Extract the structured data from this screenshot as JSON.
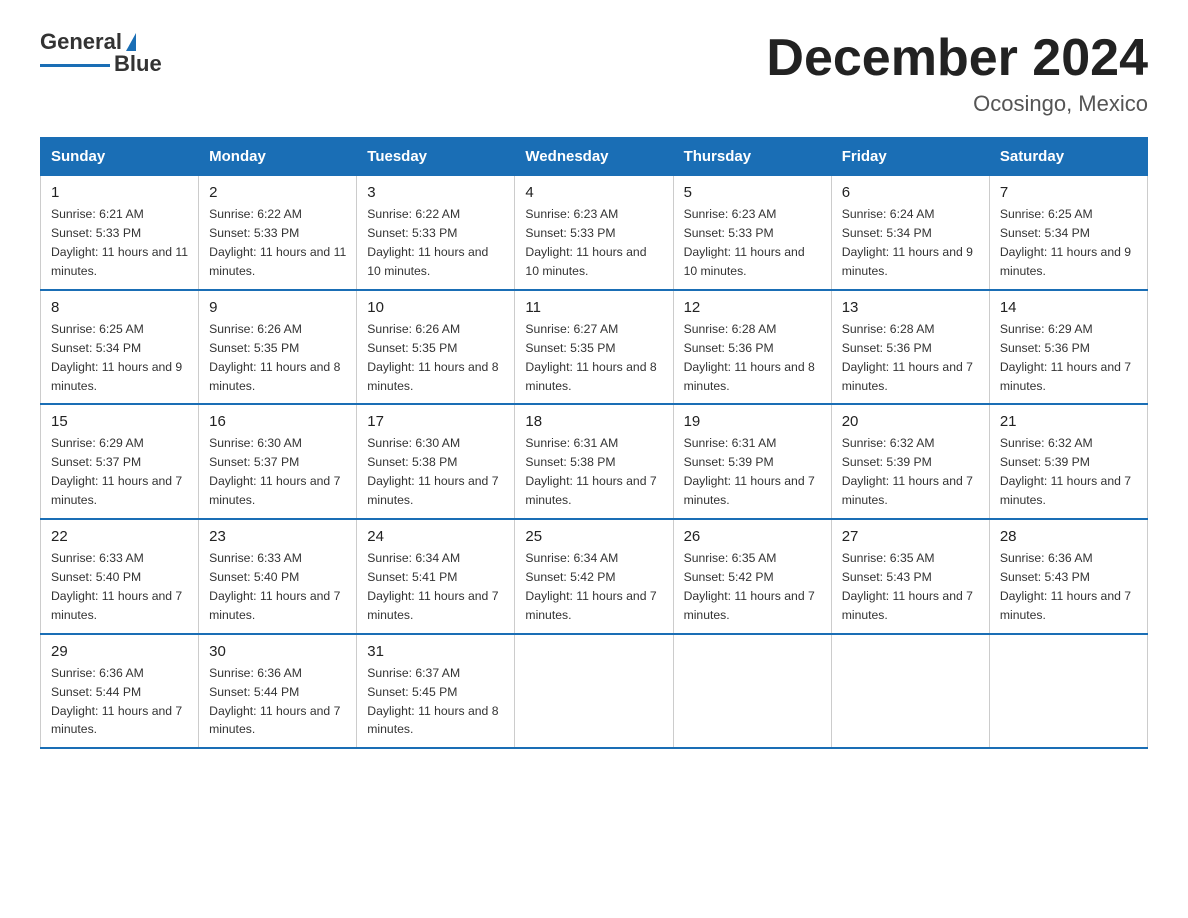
{
  "logo": {
    "general": "General",
    "blue": "Blue"
  },
  "title": "December 2024",
  "location": "Ocosingo, Mexico",
  "days_of_week": [
    "Sunday",
    "Monday",
    "Tuesday",
    "Wednesday",
    "Thursday",
    "Friday",
    "Saturday"
  ],
  "weeks": [
    [
      {
        "day": "1",
        "sunrise": "6:21 AM",
        "sunset": "5:33 PM",
        "daylight": "11 hours and 11 minutes."
      },
      {
        "day": "2",
        "sunrise": "6:22 AM",
        "sunset": "5:33 PM",
        "daylight": "11 hours and 11 minutes."
      },
      {
        "day": "3",
        "sunrise": "6:22 AM",
        "sunset": "5:33 PM",
        "daylight": "11 hours and 10 minutes."
      },
      {
        "day": "4",
        "sunrise": "6:23 AM",
        "sunset": "5:33 PM",
        "daylight": "11 hours and 10 minutes."
      },
      {
        "day": "5",
        "sunrise": "6:23 AM",
        "sunset": "5:33 PM",
        "daylight": "11 hours and 10 minutes."
      },
      {
        "day": "6",
        "sunrise": "6:24 AM",
        "sunset": "5:34 PM",
        "daylight": "11 hours and 9 minutes."
      },
      {
        "day": "7",
        "sunrise": "6:25 AM",
        "sunset": "5:34 PM",
        "daylight": "11 hours and 9 minutes."
      }
    ],
    [
      {
        "day": "8",
        "sunrise": "6:25 AM",
        "sunset": "5:34 PM",
        "daylight": "11 hours and 9 minutes."
      },
      {
        "day": "9",
        "sunrise": "6:26 AM",
        "sunset": "5:35 PM",
        "daylight": "11 hours and 8 minutes."
      },
      {
        "day": "10",
        "sunrise": "6:26 AM",
        "sunset": "5:35 PM",
        "daylight": "11 hours and 8 minutes."
      },
      {
        "day": "11",
        "sunrise": "6:27 AM",
        "sunset": "5:35 PM",
        "daylight": "11 hours and 8 minutes."
      },
      {
        "day": "12",
        "sunrise": "6:28 AM",
        "sunset": "5:36 PM",
        "daylight": "11 hours and 8 minutes."
      },
      {
        "day": "13",
        "sunrise": "6:28 AM",
        "sunset": "5:36 PM",
        "daylight": "11 hours and 7 minutes."
      },
      {
        "day": "14",
        "sunrise": "6:29 AM",
        "sunset": "5:36 PM",
        "daylight": "11 hours and 7 minutes."
      }
    ],
    [
      {
        "day": "15",
        "sunrise": "6:29 AM",
        "sunset": "5:37 PM",
        "daylight": "11 hours and 7 minutes."
      },
      {
        "day": "16",
        "sunrise": "6:30 AM",
        "sunset": "5:37 PM",
        "daylight": "11 hours and 7 minutes."
      },
      {
        "day": "17",
        "sunrise": "6:30 AM",
        "sunset": "5:38 PM",
        "daylight": "11 hours and 7 minutes."
      },
      {
        "day": "18",
        "sunrise": "6:31 AM",
        "sunset": "5:38 PM",
        "daylight": "11 hours and 7 minutes."
      },
      {
        "day": "19",
        "sunrise": "6:31 AM",
        "sunset": "5:39 PM",
        "daylight": "11 hours and 7 minutes."
      },
      {
        "day": "20",
        "sunrise": "6:32 AM",
        "sunset": "5:39 PM",
        "daylight": "11 hours and 7 minutes."
      },
      {
        "day": "21",
        "sunrise": "6:32 AM",
        "sunset": "5:39 PM",
        "daylight": "11 hours and 7 minutes."
      }
    ],
    [
      {
        "day": "22",
        "sunrise": "6:33 AM",
        "sunset": "5:40 PM",
        "daylight": "11 hours and 7 minutes."
      },
      {
        "day": "23",
        "sunrise": "6:33 AM",
        "sunset": "5:40 PM",
        "daylight": "11 hours and 7 minutes."
      },
      {
        "day": "24",
        "sunrise": "6:34 AM",
        "sunset": "5:41 PM",
        "daylight": "11 hours and 7 minutes."
      },
      {
        "day": "25",
        "sunrise": "6:34 AM",
        "sunset": "5:42 PM",
        "daylight": "11 hours and 7 minutes."
      },
      {
        "day": "26",
        "sunrise": "6:35 AM",
        "sunset": "5:42 PM",
        "daylight": "11 hours and 7 minutes."
      },
      {
        "day": "27",
        "sunrise": "6:35 AM",
        "sunset": "5:43 PM",
        "daylight": "11 hours and 7 minutes."
      },
      {
        "day": "28",
        "sunrise": "6:36 AM",
        "sunset": "5:43 PM",
        "daylight": "11 hours and 7 minutes."
      }
    ],
    [
      {
        "day": "29",
        "sunrise": "6:36 AM",
        "sunset": "5:44 PM",
        "daylight": "11 hours and 7 minutes."
      },
      {
        "day": "30",
        "sunrise": "6:36 AM",
        "sunset": "5:44 PM",
        "daylight": "11 hours and 7 minutes."
      },
      {
        "day": "31",
        "sunrise": "6:37 AM",
        "sunset": "5:45 PM",
        "daylight": "11 hours and 8 minutes."
      },
      null,
      null,
      null,
      null
    ]
  ]
}
